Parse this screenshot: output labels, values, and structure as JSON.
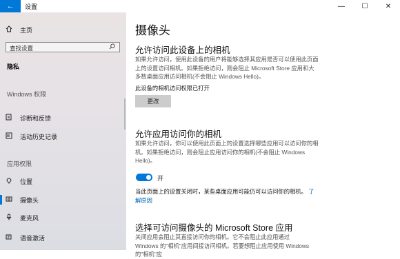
{
  "window": {
    "title": "设置",
    "back_icon": "←",
    "minimize": "—",
    "maximize": "☐",
    "close": "✕"
  },
  "sidebar": {
    "home_label": "主页",
    "search_placeholder": "查找设置",
    "section_privacy": "隐私",
    "section_windows_perms": "Windows 权限",
    "items_windows": [
      {
        "label": "诊断和反馈",
        "icon": "diagnostics-icon"
      },
      {
        "label": "活动历史记录",
        "icon": "activity-history-icon"
      }
    ],
    "section_app_perms": "应用权限",
    "items_app": [
      {
        "label": "位置",
        "icon": "location-icon"
      },
      {
        "label": "摄像头",
        "icon": "camera-icon",
        "selected": true
      },
      {
        "label": "麦克风",
        "icon": "microphone-icon"
      },
      {
        "label": "语音激活",
        "icon": "voice-activation-icon"
      }
    ]
  },
  "main": {
    "title": "摄像头",
    "section1_heading": "允许访问此设备上的相机",
    "section1_desc": "如果允许访问，使用此设备的用户将能够选择其应用是否可以使用此页面上的设置访问相机。如果拒绝访问，则会阻止 Microsoft Store 应用和大多数桌面应用访问相机(不会阻止 Windows Hello)。",
    "device_status": "此设备的相机访问权限已打开",
    "change_button": "更改",
    "section2_heading": "允许应用访问你的相机",
    "section2_desc": "如果允许访问，你可以使用此页面上的设置选择哪些应用可以访问你的相机。如果拒绝访问，则会阻止应用访问你的相机(不会阻止 Windows Hello)。",
    "toggle_state": "开",
    "toggle_on": true,
    "note_text": "当此页面上的设置关闭时，某些桌面应用可能仍可以访问你的相机。",
    "note_link": "了解原因",
    "section3_heading": "选择可访问摄像头的 Microsoft Store 应用",
    "section3_desc": "关闭应用会阻止其直接访问你的相机。它不会阻止此应用通过 Windows 的\"相机\"应用间接访问相机。若要想阻止应用使用 Windows 的\"相机\"应"
  },
  "colors": {
    "accent": "#0078d7",
    "link": "#0066b4"
  }
}
